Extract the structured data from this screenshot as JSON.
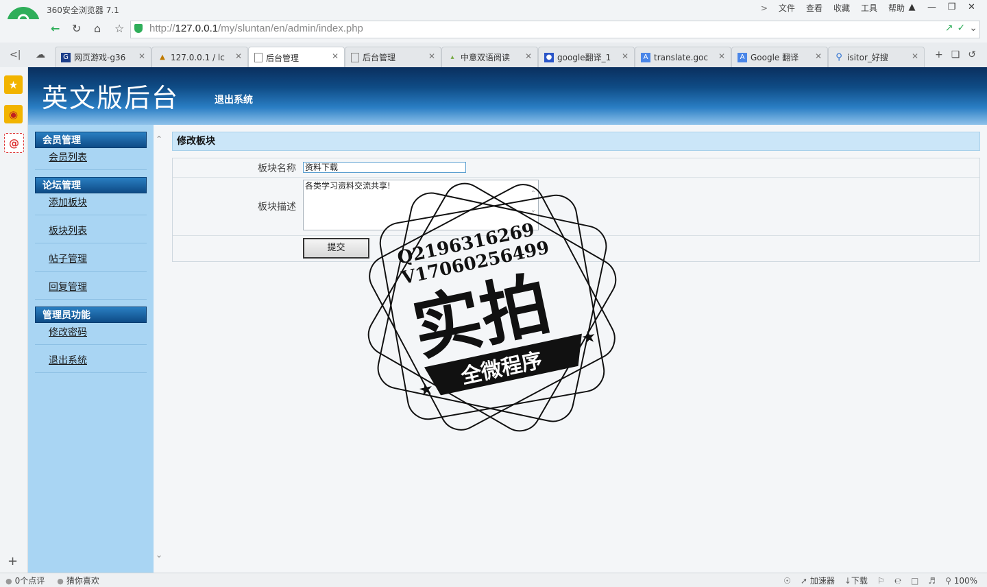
{
  "browser": {
    "title": "360安全浏览器 7.1",
    "menu": [
      "文件",
      "查看",
      "收藏",
      "工具",
      "帮助"
    ],
    "url_host": "127.0.0.1",
    "url_prefix": "http://",
    "url_path": "/my/sluntan/en/admin/index.php",
    "tabs": [
      {
        "label": "网页游戏-g36",
        "icon": "game-icon",
        "active": false
      },
      {
        "label": "127.0.0.1 / lc",
        "icon": "phpmyadmin-icon",
        "active": false
      },
      {
        "label": "后台管理",
        "icon": "page-icon",
        "active": true
      },
      {
        "label": "后台管理",
        "icon": "page-icon",
        "active": false
      },
      {
        "label": "中意双语阅读",
        "icon": "book-icon",
        "active": false
      },
      {
        "label": "google翻译_1",
        "icon": "paw-icon",
        "active": false
      },
      {
        "label": "translate.goc",
        "icon": "translate-icon",
        "active": false
      },
      {
        "label": "Google 翻译",
        "icon": "translate-icon",
        "active": false
      },
      {
        "label": "isitor_好搜",
        "icon": "search-icon",
        "active": false
      }
    ]
  },
  "site": {
    "title": "英文版后台",
    "logout_top": "退出系统"
  },
  "sidebar": {
    "groups": [
      {
        "title": "会员管理",
        "items": [
          "会员列表"
        ]
      },
      {
        "title": "论坛管理",
        "items": [
          "添加板块",
          "板块列表",
          "帖子管理",
          "回复管理"
        ]
      },
      {
        "title": "管理员功能",
        "items": [
          "修改密码",
          "退出系统"
        ]
      }
    ]
  },
  "form": {
    "heading": "修改板块",
    "name_label": "板块名称",
    "name_value": "资料下载",
    "desc_label": "板块描述",
    "desc_value": "各类学习资料交流共享!",
    "submit_label": "提交"
  },
  "watermark": {
    "line1": "Q2196316269",
    "line2": "V17060256499",
    "big": "实拍",
    "banner": "全微程序"
  },
  "statusbar": {
    "left": [
      "0个点评",
      "猜你喜欢"
    ],
    "accelerator": "加速器",
    "download": "下载",
    "zoom": "100%"
  }
}
